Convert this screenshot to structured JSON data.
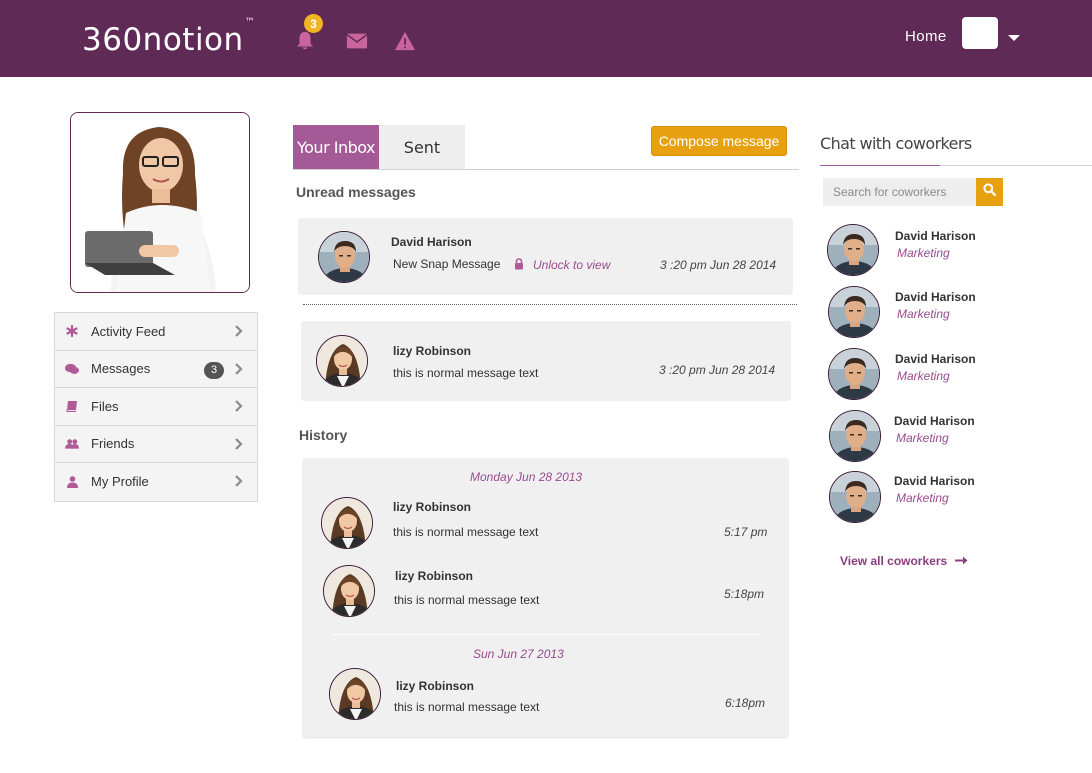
{
  "header": {
    "logo": "360notion",
    "logo_tm": "™",
    "notification_count": "3",
    "home_label": "Home",
    "icons": [
      "bell-icon",
      "envelope-icon",
      "warning-icon"
    ]
  },
  "sidebar": {
    "items": [
      {
        "label": "Activity Feed",
        "icon": "asterisk-icon"
      },
      {
        "label": "Messages",
        "icon": "chat-icon",
        "badge": "3"
      },
      {
        "label": "Files",
        "icon": "book-icon"
      },
      {
        "label": "Friends",
        "icon": "users-icon"
      },
      {
        "label": "My Profile",
        "icon": "user-icon"
      }
    ]
  },
  "tabs": {
    "inbox": "Your Inbox",
    "sent": "Sent",
    "compose": "Compose message"
  },
  "unread": {
    "heading": "Unread messages",
    "messages": [
      {
        "name": "David Harison",
        "text": "New Snap Message",
        "unlock": "Unlock to view",
        "time": "3 :20 pm Jun 28 2014"
      },
      {
        "name": "lizy Robinson",
        "text": "this is normal message text",
        "time": "3 :20 pm Jun 28 2014"
      }
    ]
  },
  "history": {
    "heading": "History",
    "groups": [
      {
        "date": "Monday Jun 28 2013",
        "messages": [
          {
            "name": "lizy Robinson",
            "text": "this is normal message text",
            "time": "5:17 pm"
          },
          {
            "name": "lizy Robinson",
            "text": "this is normal message text",
            "time": "5:18pm"
          }
        ]
      },
      {
        "date": "Sun  Jun 27 2013",
        "messages": [
          {
            "name": "lizy Robinson",
            "text": "this is normal message text",
            "time": "6:18pm"
          }
        ]
      }
    ]
  },
  "chat": {
    "title": "Chat with coworkers",
    "search_placeholder": "Search for coworkers",
    "coworkers": [
      {
        "name": "David Harison",
        "role": "Marketing"
      },
      {
        "name": "David Harison",
        "role": "Marketing"
      },
      {
        "name": "David Harison",
        "role": "Marketing"
      },
      {
        "name": "David Harison",
        "role": "Marketing"
      },
      {
        "name": "David Harison",
        "role": "Marketing"
      }
    ],
    "view_all": "View all coworkers"
  },
  "colors": {
    "header_bg": "#5f2a55",
    "accent_purple": "#a35a96",
    "accent_orange": "#e8a10e",
    "icon_pink": "#c9649e"
  }
}
